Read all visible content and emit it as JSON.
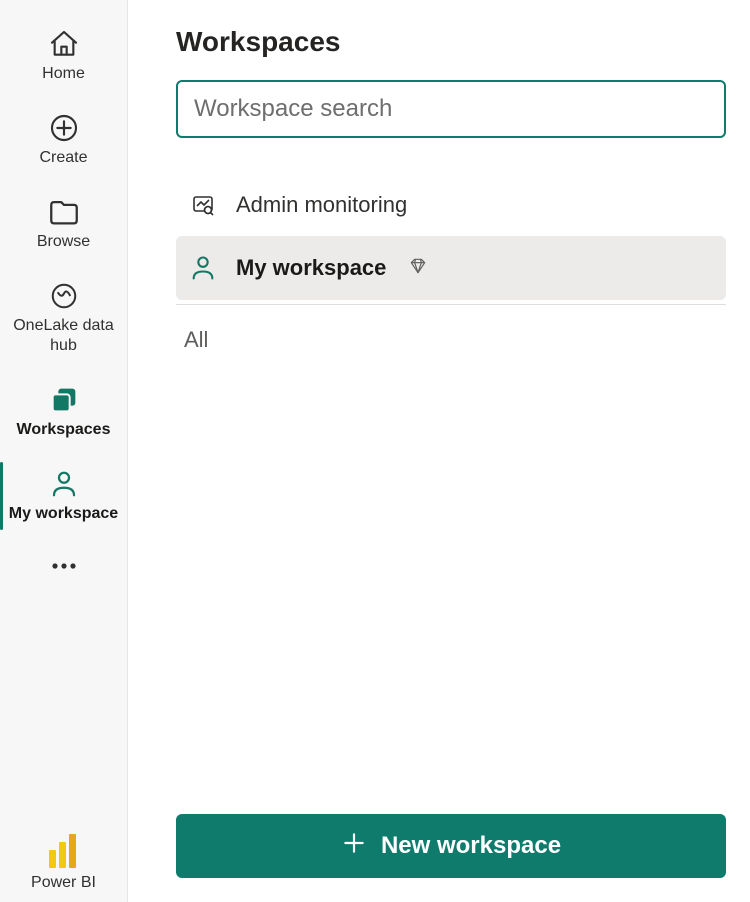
{
  "nav": {
    "home": "Home",
    "create": "Create",
    "browse": "Browse",
    "onelake": "OneLake data hub",
    "workspaces": "Workspaces",
    "myworkspace": "My workspace",
    "powerbi": "Power BI"
  },
  "panel": {
    "title": "Workspaces",
    "search_placeholder": "Workspace search",
    "admin_monitoring": "Admin monitoring",
    "my_workspace": "My workspace",
    "section_all": "All",
    "new_workspace": "New workspace"
  },
  "colors": {
    "accent": "#0f7b6c"
  }
}
